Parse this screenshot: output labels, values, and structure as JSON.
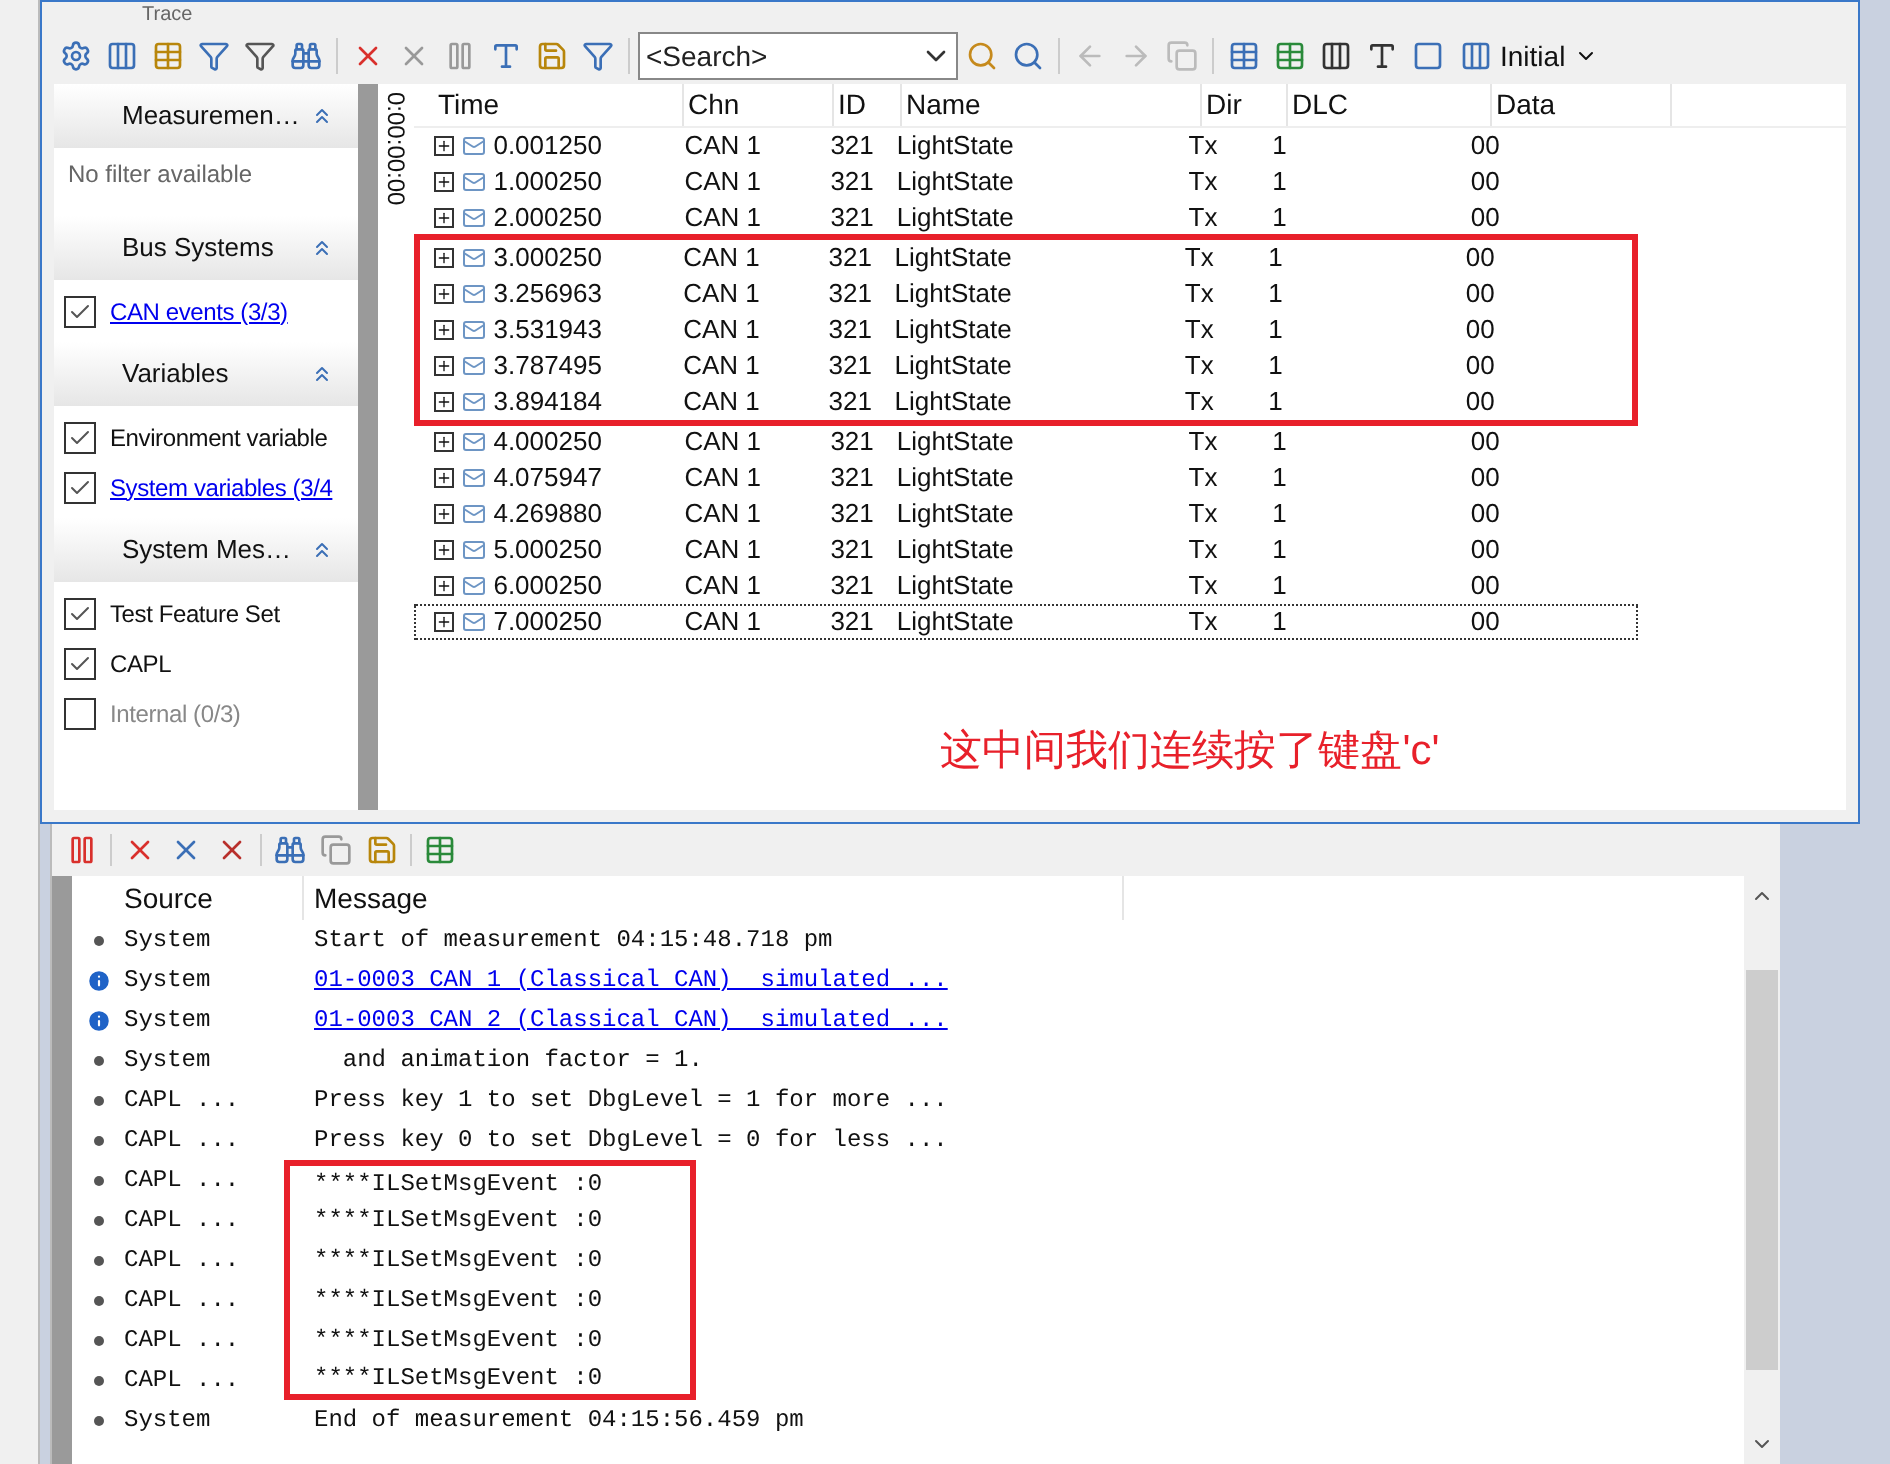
{
  "window": {
    "title": "Trace"
  },
  "toolbar": {
    "search": {
      "placeholder": "<Search>"
    },
    "layout_button": "Initial"
  },
  "filter_panel": {
    "sections": [
      {
        "title": "Measuremen…",
        "empty_text": "No filter available"
      },
      {
        "title": "Bus Systems",
        "items": [
          {
            "label": "CAN events (3/3)",
            "checked": true,
            "link": true,
            "disabled": false
          }
        ]
      },
      {
        "title": "Variables",
        "items": [
          {
            "label": "Environment variable",
            "checked": true,
            "link": false,
            "disabled": false
          },
          {
            "label": "System variables (3/4",
            "checked": true,
            "link": true,
            "disabled": false
          }
        ]
      },
      {
        "title": "System Mes…",
        "items": [
          {
            "label": "Test Feature Set",
            "checked": true,
            "link": false,
            "disabled": false
          },
          {
            "label": "CAPL",
            "checked": true,
            "link": false,
            "disabled": false
          },
          {
            "label": "Internal (0/3)",
            "checked": false,
            "link": false,
            "disabled": true
          }
        ]
      }
    ]
  },
  "time_ruler": "0:00:00:00",
  "trace_table": {
    "columns": [
      "Time",
      "Chn",
      "ID",
      "Name",
      "Dir",
      "DLC",
      "Data"
    ],
    "rows": [
      {
        "time": "0.001250",
        "chn": "CAN 1",
        "id": "321",
        "name": "LightState",
        "dir": "Tx",
        "dlc": "1",
        "data": "00",
        "selected": false,
        "highlighted": false
      },
      {
        "time": "1.000250",
        "chn": "CAN 1",
        "id": "321",
        "name": "LightState",
        "dir": "Tx",
        "dlc": "1",
        "data": "00",
        "selected": false,
        "highlighted": false
      },
      {
        "time": "2.000250",
        "chn": "CAN 1",
        "id": "321",
        "name": "LightState",
        "dir": "Tx",
        "dlc": "1",
        "data": "00",
        "selected": false,
        "highlighted": false
      },
      {
        "time": "3.000250",
        "chn": "CAN 1",
        "id": "321",
        "name": "LightState",
        "dir": "Tx",
        "dlc": "1",
        "data": "00",
        "selected": false,
        "highlighted": true
      },
      {
        "time": "3.256963",
        "chn": "CAN 1",
        "id": "321",
        "name": "LightState",
        "dir": "Tx",
        "dlc": "1",
        "data": "00",
        "selected": false,
        "highlighted": true
      },
      {
        "time": "3.531943",
        "chn": "CAN 1",
        "id": "321",
        "name": "LightState",
        "dir": "Tx",
        "dlc": "1",
        "data": "00",
        "selected": false,
        "highlighted": true
      },
      {
        "time": "3.787495",
        "chn": "CAN 1",
        "id": "321",
        "name": "LightState",
        "dir": "Tx",
        "dlc": "1",
        "data": "00",
        "selected": false,
        "highlighted": true
      },
      {
        "time": "3.894184",
        "chn": "CAN 1",
        "id": "321",
        "name": "LightState",
        "dir": "Tx",
        "dlc": "1",
        "data": "00",
        "selected": false,
        "highlighted": true
      },
      {
        "time": "4.000250",
        "chn": "CAN 1",
        "id": "321",
        "name": "LightState",
        "dir": "Tx",
        "dlc": "1",
        "data": "00",
        "selected": false,
        "highlighted": false
      },
      {
        "time": "4.075947",
        "chn": "CAN 1",
        "id": "321",
        "name": "LightState",
        "dir": "Tx",
        "dlc": "1",
        "data": "00",
        "selected": false,
        "highlighted": false
      },
      {
        "time": "4.269880",
        "chn": "CAN 1",
        "id": "321",
        "name": "LightState",
        "dir": "Tx",
        "dlc": "1",
        "data": "00",
        "selected": false,
        "highlighted": false
      },
      {
        "time": "5.000250",
        "chn": "CAN 1",
        "id": "321",
        "name": "LightState",
        "dir": "Tx",
        "dlc": "1",
        "data": "00",
        "selected": false,
        "highlighted": false
      },
      {
        "time": "6.000250",
        "chn": "CAN 1",
        "id": "321",
        "name": "LightState",
        "dir": "Tx",
        "dlc": "1",
        "data": "00",
        "selected": false,
        "highlighted": false
      },
      {
        "time": "7.000250",
        "chn": "CAN 1",
        "id": "321",
        "name": "LightState",
        "dir": "Tx",
        "dlc": "1",
        "data": "00",
        "selected": true,
        "highlighted": false
      }
    ]
  },
  "annotation": "这中间我们连续按了键盘'c'",
  "write_window": {
    "columns": [
      "Source",
      "Message"
    ],
    "rows": [
      {
        "kind": "bullet",
        "source": "System",
        "message": "Start of measurement 04:15:48.718 pm",
        "link": false,
        "highlighted": false
      },
      {
        "kind": "info",
        "source": "System",
        "message": "01-0003 CAN 1 (Classical CAN)  simulated ...",
        "link": true,
        "highlighted": false
      },
      {
        "kind": "info",
        "source": "System",
        "message": "01-0003 CAN 2 (Classical CAN)  simulated ...",
        "link": true,
        "highlighted": false
      },
      {
        "kind": "bullet",
        "source": "System",
        "message": "  and animation factor = 1.",
        "link": false,
        "highlighted": false
      },
      {
        "kind": "bullet",
        "source": "CAPL ...",
        "message": "Press key 1 to set DbgLevel = 1 for more ...",
        "link": false,
        "highlighted": false
      },
      {
        "kind": "bullet",
        "source": "CAPL ...",
        "message": "Press key 0 to set DbgLevel = 0 for less ...",
        "link": false,
        "highlighted": false
      },
      {
        "kind": "bullet",
        "source": "CAPL ...",
        "message": "****ILSetMsgEvent :0",
        "link": false,
        "highlighted": true
      },
      {
        "kind": "bullet",
        "source": "CAPL ...",
        "message": "****ILSetMsgEvent :0",
        "link": false,
        "highlighted": true
      },
      {
        "kind": "bullet",
        "source": "CAPL ...",
        "message": "****ILSetMsgEvent :0",
        "link": false,
        "highlighted": true
      },
      {
        "kind": "bullet",
        "source": "CAPL ...",
        "message": "****ILSetMsgEvent :0",
        "link": false,
        "highlighted": true
      },
      {
        "kind": "bullet",
        "source": "CAPL ...",
        "message": "****ILSetMsgEvent :0",
        "link": false,
        "highlighted": true
      },
      {
        "kind": "bullet",
        "source": "CAPL ...",
        "message": "****ILSetMsgEvent :0",
        "link": false,
        "highlighted": true
      },
      {
        "kind": "bullet",
        "source": "System",
        "message": "End of measurement 04:15:56.459 pm",
        "link": false,
        "highlighted": false
      }
    ]
  }
}
